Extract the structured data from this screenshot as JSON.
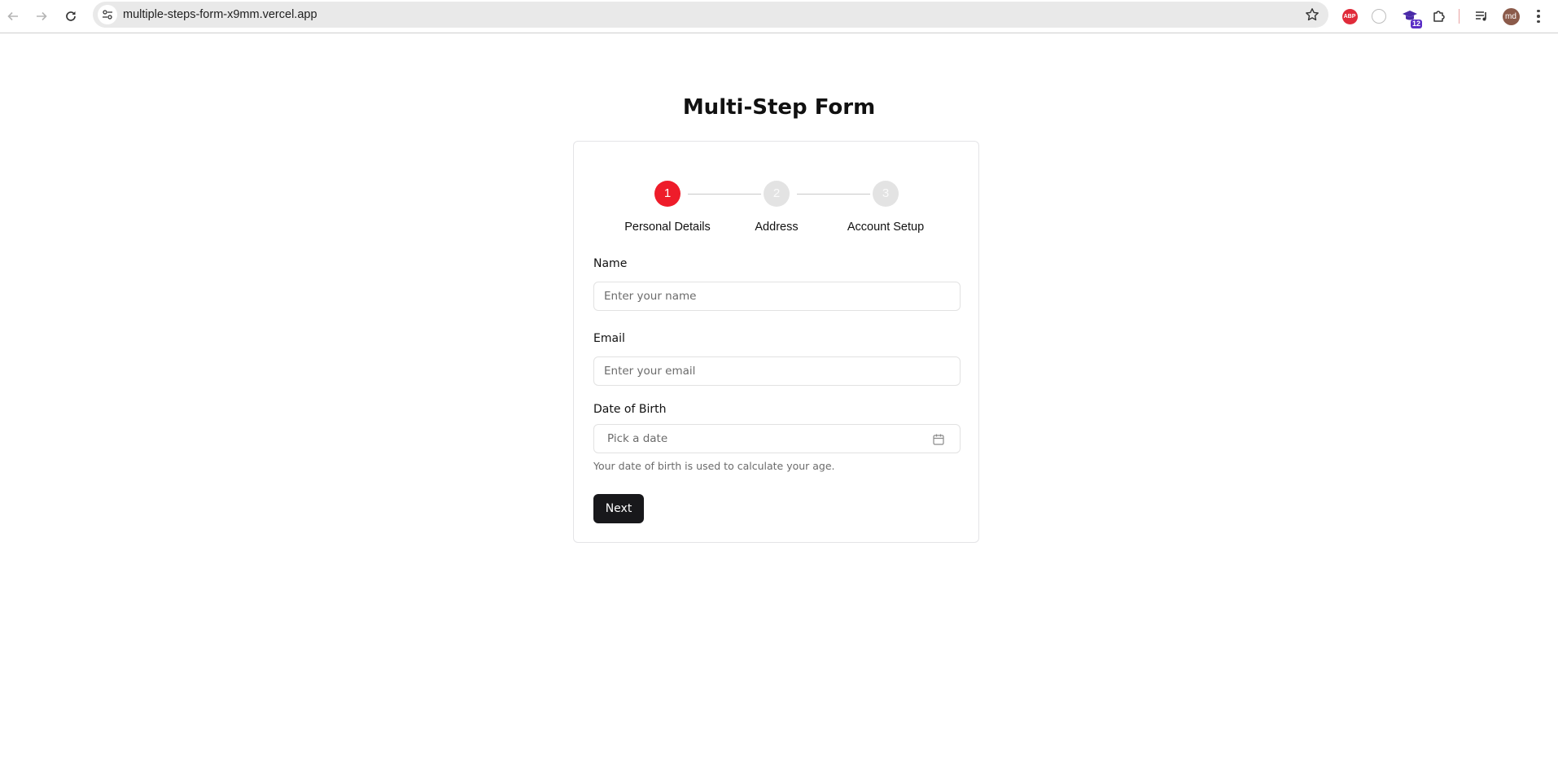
{
  "browser": {
    "url": "multiple-steps-form-x9mm.vercel.app",
    "extensions": [
      {
        "name": "adblock-plus-icon",
        "label": "ABP"
      },
      {
        "name": "ghost-extension-icon",
        "label": ""
      },
      {
        "name": "graduation-hat-extension-icon",
        "badge": "12"
      },
      {
        "name": "puzzle-extensions-icon",
        "label": ""
      },
      {
        "name": "media-controls-icon",
        "label": ""
      }
    ],
    "profile_initials": "md"
  },
  "form": {
    "title": "Multi-Step Form",
    "steps": [
      {
        "number": "1",
        "label": "Personal Details",
        "state": "active"
      },
      {
        "number": "2",
        "label": "Address",
        "state": "inactive"
      },
      {
        "number": "3",
        "label": "Account Setup",
        "state": "inactive"
      }
    ],
    "fields": {
      "name": {
        "label": "Name",
        "placeholder": "Enter your name",
        "value": ""
      },
      "email": {
        "label": "Email",
        "placeholder": "Enter your email",
        "value": ""
      },
      "dob": {
        "label": "Date of Birth",
        "placeholder": "Pick a date",
        "helper": "Your date of birth is used to calculate your age."
      }
    },
    "next_label": "Next"
  },
  "colors": {
    "active_step": "#ee1c2a",
    "inactive_step": "#e3e3e3",
    "primary_button": "#18181b"
  }
}
